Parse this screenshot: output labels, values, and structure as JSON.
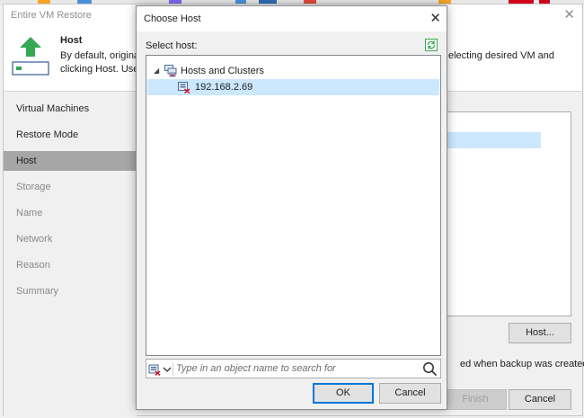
{
  "wizard": {
    "title": "Entire VM Restore",
    "header": {
      "title": "Host",
      "desc_left": "By default, original\nclicking Host. Use",
      "desc_right": "electing desired VM and"
    },
    "steps": [
      {
        "label": "Virtual Machines",
        "state": "done"
      },
      {
        "label": "Restore Mode",
        "state": "done"
      },
      {
        "label": "Host",
        "state": "active"
      },
      {
        "label": "Storage",
        "state": "disabled"
      },
      {
        "label": "Name",
        "state": "disabled"
      },
      {
        "label": "Network",
        "state": "disabled"
      },
      {
        "label": "Reason",
        "state": "disabled"
      },
      {
        "label": "Summary",
        "state": "disabled"
      }
    ],
    "host_button": "Host...",
    "note": "ed when backup was created.",
    "finish_button": "Finish",
    "cancel_button": "Cancel"
  },
  "dialog": {
    "title": "Choose Host",
    "label": "Select host:",
    "tree": [
      {
        "label": "Hosts and Clusters",
        "level": 0,
        "expanded": true,
        "icon": "hosts-clusters-icon",
        "selected": false
      },
      {
        "label": "192.168.2.69",
        "level": 1,
        "expanded": false,
        "icon": "host-icon",
        "selected": true
      }
    ],
    "search": {
      "placeholder": "Type in an object name to search for",
      "value": ""
    },
    "ok_button": "OK",
    "cancel_button": "Cancel"
  },
  "colors": {
    "selection": "#cce8ff",
    "active_step": "#a6a6a6",
    "accent": "#0078d7",
    "arrow_green": "#34a853"
  }
}
